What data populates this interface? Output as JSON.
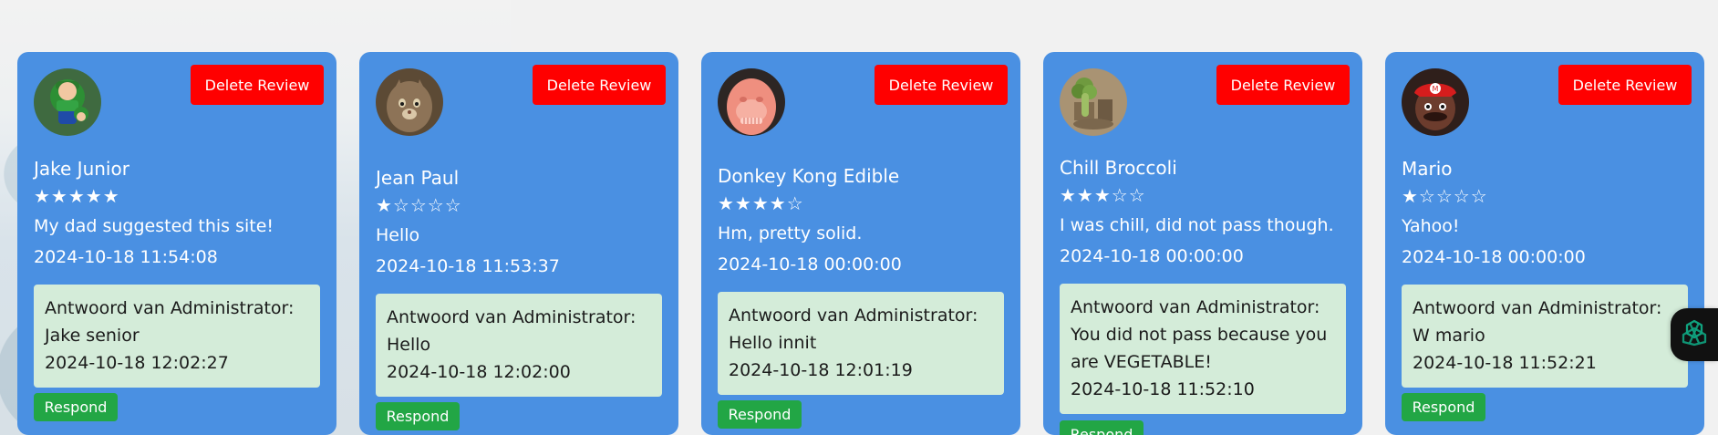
{
  "theme": {
    "card_color": "#4a90e2",
    "delete_color": "#ff0000",
    "respond_color": "#22a645",
    "admin_box_color": "#d4ecd9",
    "chat_accent": "#10a37f"
  },
  "reviews": [
    {
      "delete_label": "Delete Review",
      "name": "Jake Junior",
      "rating_text": "★★★★★",
      "comment": "My dad suggested this site!",
      "timestamp": "2024-10-18 11:54:08",
      "admin": {
        "heading": "Antwoord van Administrator:",
        "reply": "Jake senior",
        "timestamp": "2024-10-18 12:02:27"
      },
      "respond_label": "Respond",
      "avatar_icon": "luigi-avatar-icon"
    },
    {
      "delete_label": "Delete Review",
      "name": "Jean Paul",
      "rating_text": "★☆☆☆☆",
      "comment": "Hello",
      "timestamp": "2024-10-18 11:53:37",
      "admin": {
        "heading": "Antwoord van Administrator:",
        "reply": "Hello",
        "timestamp": "2024-10-18 12:02:00"
      },
      "respond_label": "Respond",
      "avatar_icon": "cat-avatar-icon"
    },
    {
      "delete_label": "Delete Review",
      "name": "Donkey Kong Edible",
      "rating_text": "★★★★☆",
      "comment": "Hm, pretty solid.",
      "timestamp": "2024-10-18 00:00:00",
      "admin": {
        "heading": "Antwoord van Administrator:",
        "reply": "Hello innit",
        "timestamp": "2024-10-18 12:01:19"
      },
      "respond_label": "Respond",
      "avatar_icon": "donkey-kong-avatar-icon"
    },
    {
      "delete_label": "Delete Review",
      "name": "Chill Broccoli",
      "rating_text": "★★★☆☆",
      "comment": "I was chill, did not pass though.",
      "timestamp": "2024-10-18 00:00:00",
      "admin": {
        "heading": "Antwoord van Administrator:",
        "reply": "You did not pass because you are VEGETABLE!",
        "timestamp": "2024-10-18 11:52:10"
      },
      "respond_label": "Respond",
      "avatar_icon": "broccoli-avatar-icon"
    },
    {
      "delete_label": "Delete Review",
      "name": "Mario",
      "rating_text": "★☆☆☆☆",
      "comment": "Yahoo!",
      "timestamp": "2024-10-18 00:00:00",
      "admin": {
        "heading": "Antwoord van Administrator:",
        "reply": "W mario",
        "timestamp": "2024-10-18 11:52:21"
      },
      "respond_label": "Respond",
      "avatar_icon": "mario-avatar-icon"
    }
  ],
  "chat_widget_icon": "openai-chat-icon"
}
